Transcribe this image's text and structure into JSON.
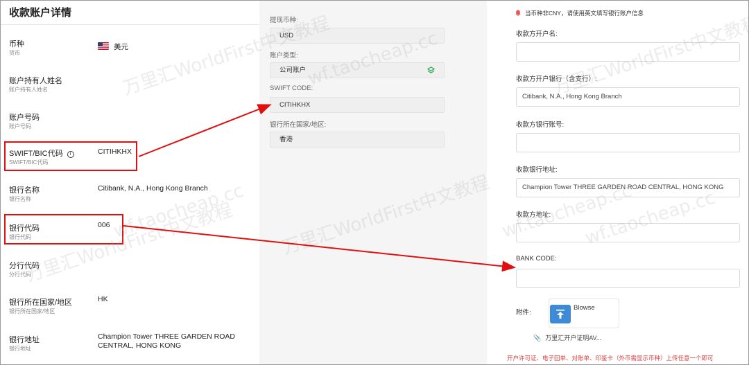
{
  "left": {
    "title": "收款账户详情",
    "rows": [
      {
        "label": "币种",
        "sub": "货币",
        "value": "美元"
      },
      {
        "label": "账户持有人姓名",
        "sub": "账户持有人姓名",
        "value": ""
      },
      {
        "label": "账户号码",
        "sub": "账户号码",
        "value": ""
      },
      {
        "label": "SWIFT/BIC代码",
        "sub": "SWIFT/BIC代码",
        "value": "CITIHKHX"
      },
      {
        "label": "银行名称",
        "sub": "银行名称",
        "value": "Citibank, N.A., Hong Kong Branch"
      },
      {
        "label": "银行代码",
        "sub": "银行代码",
        "value": "006"
      },
      {
        "label": "分行代码",
        "sub": "分行代码",
        "value": ""
      },
      {
        "label": "银行所在国家/地区",
        "sub": "银行所在国家/地区",
        "value": "HK"
      },
      {
        "label": "银行地址",
        "sub": "银行地址",
        "value": "Champion Tower THREE GARDEN ROAD CENTRAL, HONG KONG"
      }
    ]
  },
  "mid": {
    "fields": [
      {
        "label": "提现币种:",
        "value": "USD"
      },
      {
        "label": "账户类型:",
        "value": "公司账户"
      },
      {
        "label": "SWIFT CODE:",
        "value": "CITIHKHX"
      },
      {
        "label": "银行所在国家/地区:",
        "value": "香港"
      }
    ]
  },
  "right": {
    "notice": "当币种非CNY，请使用英文填写银行账户信息",
    "fields": [
      {
        "label": "收款方开户名:",
        "value": ""
      },
      {
        "label": "收款方开户银行（含支行）:",
        "value": "Citibank, N.A., Hong Kong Branch"
      },
      {
        "label": "收款方银行账号:",
        "value": ""
      },
      {
        "label": "收款银行地址:",
        "value": "Champion Tower THREE GARDEN ROAD CENTRAL, HONG KONG"
      },
      {
        "label": "收款方地址:",
        "value": ""
      },
      {
        "label": "BANK CODE:",
        "value": ""
      }
    ],
    "attach_label": "附件:",
    "upload_label": "Blowse",
    "file_name": "万里汇开户证明AV...",
    "note": "开户许可证、电子回单、对账单、印鉴卡（外币需显示币种）上传任意一个即可"
  },
  "watermarks": [
    "万里汇WorldFirst中文教程",
    "wf.taocheap.cc",
    "万里汇WorldFirst中文教程",
    "wf.taocheap.cc",
    "万里汇WorldFirst中文教程",
    "wf.taocheap.cc",
    "万里汇WorldFirst中文教程",
    "wf.taocheap.cc"
  ],
  "colors": {
    "annotation": "#e01010",
    "upload_button": "#3d8bd6",
    "note": "#e04040"
  }
}
